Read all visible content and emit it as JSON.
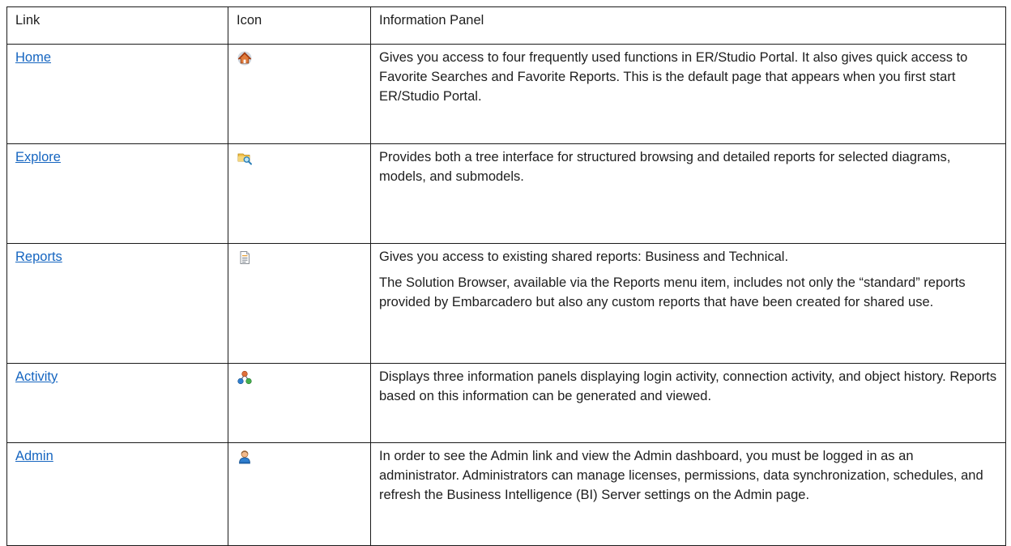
{
  "table": {
    "headers": [
      "Link",
      "Icon",
      "Information Panel"
    ],
    "rows": [
      {
        "link": "Home",
        "icon": "home-icon",
        "paragraphs": [
          "Gives you access to four frequently used functions in ER/Studio Portal. It also gives quick access to Favorite Searches and Favorite Reports. This is the default page that appears when you first start ER/Studio Portal."
        ]
      },
      {
        "link": "Explore",
        "icon": "explore-icon",
        "paragraphs": [
          "Provides both a tree interface for structured browsing and detailed reports for selected diagrams, models, and submodels."
        ]
      },
      {
        "link": "Reports",
        "icon": "reports-icon",
        "paragraphs": [
          "Gives you access to existing shared reports: Business and Technical.",
          "The Solution Browser, available via the Reports menu item, includes not only the “standard” reports provided by Embarcadero but also any custom reports that have been created for shared use."
        ]
      },
      {
        "link": "Activity",
        "icon": "activity-icon",
        "paragraphs": [
          "Displays three information panels displaying login activity, connection activity, and object history. Reports based on this information can be generated and viewed."
        ]
      },
      {
        "link": "Admin",
        "icon": "admin-icon",
        "paragraphs": [
          "In order to see the Admin link and view the Admin dashboard, you must be logged in as an administrator. Administrators can manage licenses, permissions, data synchronization, schedules, and refresh the Business Intelligence (BI) Server settings on the Admin page."
        ]
      }
    ]
  }
}
